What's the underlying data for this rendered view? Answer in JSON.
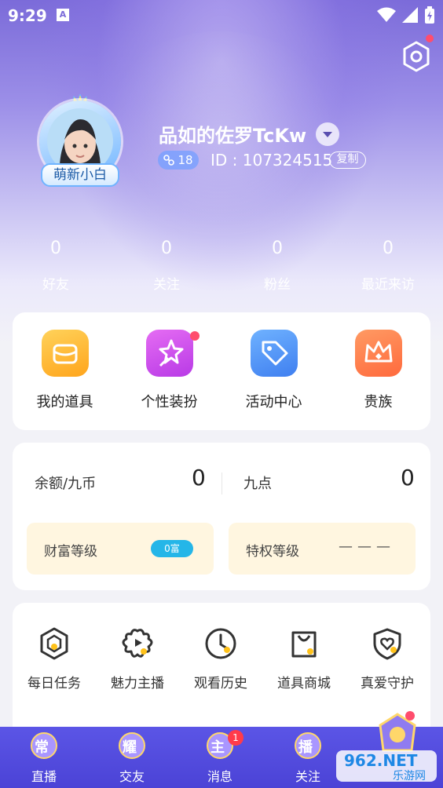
{
  "status_bar": {
    "time": "9:29",
    "notification_letter": "A"
  },
  "profile": {
    "username": "品如的佐罗TcKw",
    "level": "18",
    "id_text": "ID : 107324515",
    "copy_label": "复制",
    "avatar_badge": "萌新小白"
  },
  "stats": [
    {
      "value": "0",
      "label": "好友"
    },
    {
      "value": "0",
      "label": "关注"
    },
    {
      "value": "0",
      "label": "粉丝"
    },
    {
      "value": "0",
      "label": "最近来访"
    }
  ],
  "quick_actions": [
    {
      "label": "我的道具",
      "icon": "gift-box-icon",
      "color": "#ffb92e"
    },
    {
      "label": "个性装扮",
      "icon": "magic-wand-icon",
      "color": "#d34dee"
    },
    {
      "label": "活动中心",
      "icon": "tag-icon",
      "color": "#4a90ff"
    },
    {
      "label": "贵族",
      "icon": "crown-icon",
      "color": "#ff7a45"
    }
  ],
  "balance": {
    "coins_label": "余额/九币",
    "coins_value": "0",
    "points_label": "九点",
    "points_value": "0",
    "wealth_label": "财富等级",
    "wealth_pill": "0富",
    "privilege_label": "特权等级",
    "privilege_value": "———"
  },
  "functions": [
    {
      "label": "每日任务",
      "icon": "task-hexagon-icon"
    },
    {
      "label": "魅力主播",
      "icon": "flower-play-icon"
    },
    {
      "label": "观看历史",
      "icon": "clock-icon"
    },
    {
      "label": "道具商城",
      "icon": "shopping-bag-icon"
    },
    {
      "label": "真爱守护",
      "icon": "heart-shield-icon"
    }
  ],
  "tabbar": [
    {
      "label": "直播",
      "icon_text": "常",
      "badge": ""
    },
    {
      "label": "交友",
      "icon_text": "耀",
      "badge": ""
    },
    {
      "label": "消息",
      "icon_text": "主",
      "badge": "1"
    },
    {
      "label": "关注",
      "icon_text": "播",
      "badge": ""
    }
  ],
  "watermark": {
    "brand": "962.NET",
    "sub": "乐游网"
  },
  "colors": {
    "accent": "#5b55e6",
    "badge_red": "#ff3b4a",
    "wealth_blue": "#25b6e8"
  }
}
